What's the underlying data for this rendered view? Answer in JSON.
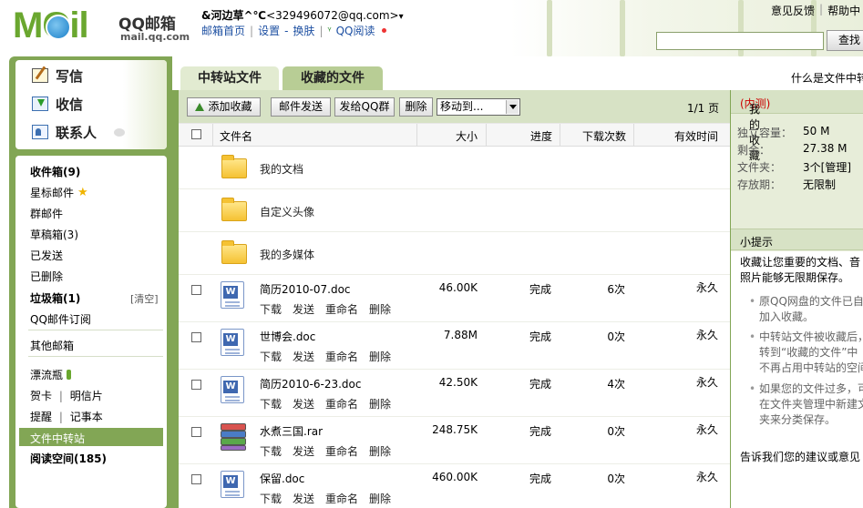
{
  "header": {
    "logo_text": "MOil",
    "logo_qq": "QQ邮箱",
    "logo_url": "mail.qq.com",
    "user_nick": "&河边草^℃",
    "user_email": "<329496072@qq.com>",
    "user_menu_arrow": "▾",
    "nav": [
      "邮箱首页",
      "设置",
      "换肤",
      "QQ阅读"
    ],
    "toplinks": [
      "意见反馈",
      "帮助中"
    ],
    "search_value": "",
    "search_button": "查找"
  },
  "left": {
    "compose": [
      "写信",
      "收信",
      "联系人"
    ],
    "folders": {
      "inbox": "收件箱(9)",
      "starred": "星标邮件",
      "group": "群邮件",
      "drafts": "草稿箱(3)",
      "sent": "已发送",
      "deleted": "已删除",
      "spam": "垃圾箱(1)",
      "clear": "[清空]",
      "subscribe": "QQ邮件订阅",
      "other": "其他邮箱",
      "bottle": "漂流瓶",
      "card": "贺卡",
      "postcard": "明信片",
      "reminder": "提醒",
      "notebook": "记事本",
      "transfer": "文件中转站",
      "reading": "阅读空间(185)"
    }
  },
  "tabs": [
    "中转站文件",
    "收藏的文件"
  ],
  "whatis": "什么是文件中转",
  "toolbar": {
    "add": "添加收藏",
    "send_mail": "邮件发送",
    "send_group": "发给QQ群",
    "delete": "删除",
    "move_to": "移动到...",
    "page_info": "1/1 页"
  },
  "columns": [
    "文件名",
    "大小",
    "进度",
    "下载次数",
    "有效时间"
  ],
  "folder_rows": [
    "我的文档",
    "自定义头像",
    "我的多媒体"
  ],
  "file_rows": [
    {
      "name": "简历2010-07.doc",
      "size": "46.00K",
      "progress": "完成",
      "downloads": "6次",
      "valid": "永久",
      "type": "doc"
    },
    {
      "name": "世博会.doc",
      "size": "7.88M",
      "progress": "完成",
      "downloads": "0次",
      "valid": "永久",
      "type": "doc"
    },
    {
      "name": "简历2010-6-23.doc",
      "size": "42.50K",
      "progress": "完成",
      "downloads": "4次",
      "valid": "永久",
      "type": "doc"
    },
    {
      "name": "水煮三国.rar",
      "size": "248.75K",
      "progress": "完成",
      "downloads": "0次",
      "valid": "永久",
      "type": "rar"
    },
    {
      "name": "保留.doc",
      "size": "460.00K",
      "progress": "完成",
      "downloads": "0次",
      "valid": "永久",
      "type": "doc"
    }
  ],
  "row_actions": [
    "下载",
    "发送",
    "重命名",
    "删除"
  ],
  "right": {
    "title": "我的收藏",
    "tag": "(内测)",
    "stats": [
      {
        "k": "独立容量：",
        "v": "50 M"
      },
      {
        "k": "剩余：",
        "v": "27.38 M"
      },
      {
        "k": "文件夹：",
        "v": "3个[管理]"
      },
      {
        "k": "存放期：",
        "v": "无限制"
      }
    ],
    "hint_title": "小提示",
    "hint_intro": [
      "收藏让您重要的文档、音",
      "照片能够无限期保存。"
    ],
    "hint_bullets": [
      [
        "原QQ网盘的文件已自",
        "加入收藏。"
      ],
      [
        "中转站文件被收藏后，",
        "转到“收藏的文件”中",
        "不再占用中转站的空间"
      ],
      [
        "如果您的文件过多，可",
        "在文件夹管理中新建文",
        "夹来分类保存。"
      ]
    ],
    "feedback": "告诉我们您的建议或意见"
  },
  "colors": {
    "frame_green": "#82a655",
    "tab_active": "#b8cd95",
    "toolbar": "#d7e2c5",
    "accent_red": "#cc0000"
  }
}
